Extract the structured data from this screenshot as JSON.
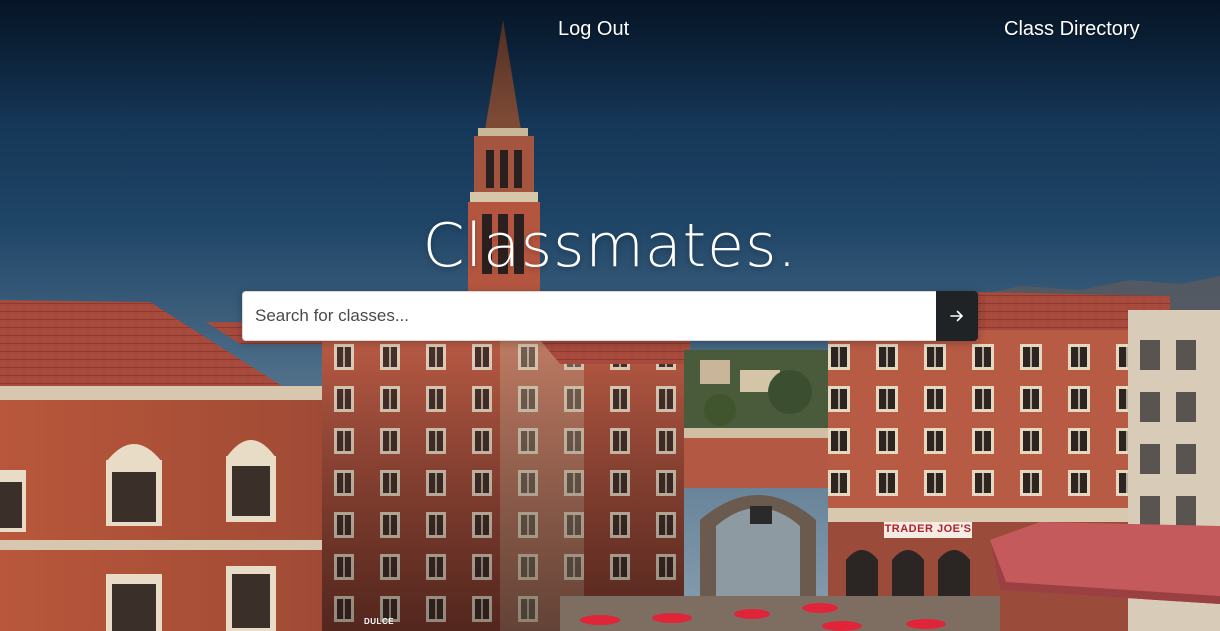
{
  "nav": {
    "logout_label": "Log Out",
    "directory_label": "Class Directory"
  },
  "hero": {
    "title": "Classmates.",
    "store_sign": "TRADER JOE'S",
    "storefront_sign": "DULCE"
  },
  "search": {
    "placeholder": "Search for classes...",
    "value": "",
    "submit_icon": "arrow-right-icon"
  },
  "colors": {
    "sky_top": "#0b2644",
    "sky_bottom": "#6f8ea6",
    "brick": "#b5543d",
    "stone": "#d9c7ae",
    "roof_tile": "#a2453a",
    "search_button": "#1f2326",
    "text": "#ffffff"
  }
}
